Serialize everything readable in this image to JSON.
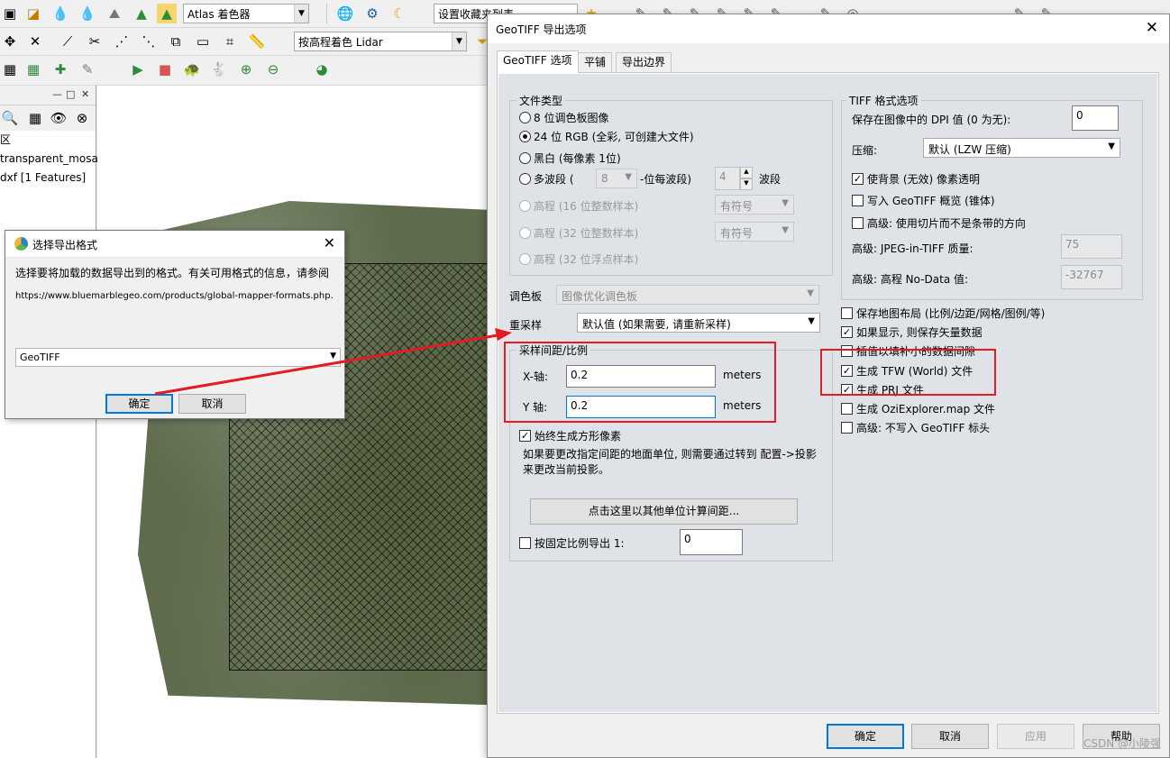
{
  "toolbar": {
    "row1": {
      "shader_select": "Atlas 着色器",
      "favorites_select": "设置收藏夹列表..."
    },
    "row2": {
      "lidar_select": "按高程着色 Lidar"
    }
  },
  "left_panel": {
    "items": [
      "区",
      "transparent_mosa",
      "dxf [1 Features]"
    ]
  },
  "select_format_dialog": {
    "title": "选择导出格式",
    "message": "选择要将加载的数据导出到的格式。有关可用格式的信息，请参阅",
    "url": "https://www.bluemarblegeo.com/products/global-mapper-formats.php.",
    "format_value": "GeoTIFF",
    "ok_label": "确定",
    "cancel_label": "取消"
  },
  "geotiff_dialog": {
    "title": "GeoTIFF 导出选项",
    "tabs": [
      "GeoTIFF 选项",
      "平铺",
      "导出边界"
    ],
    "file_type": {
      "label": "文件类型",
      "opt_8bit": "8 位调色板图像",
      "opt_24bit": "24 位 RGB (全彩, 可创建大文件)",
      "opt_bw": "黑白 (每像素 1位)",
      "opt_multi_prefix": "多波段 (",
      "multi_bits": "8",
      "multi_mid": "-位每波段)",
      "multi_bands": "4",
      "multi_suffix": "波段",
      "opt_elev16": "高程 (16 位整数样本)",
      "elev16_sign": "有符号",
      "opt_elev32i": "高程 (32 位整数样本)",
      "elev32_sign": "有符号",
      "opt_elev32f": "高程 (32 位浮点样本)"
    },
    "palette_label": "调色板",
    "palette_value": "图像优化调色板",
    "resample_label": "重采样",
    "resample_value": "默认值 (如果需要, 请重新采样)",
    "spacing": {
      "label": "采样间距/比例",
      "x_label": "X-轴:",
      "x_value": "0.2",
      "x_unit": "meters",
      "y_label": "Y 轴:",
      "y_value": "0.2",
      "y_unit": "meters",
      "square_label": "始终生成方形像素",
      "note": "如果要更改指定间距的地面单位, 则需要通过转到 配置->投影来更改当前投影。",
      "calc_button": "点击这里以其他单位计算间距...",
      "fixed_scale_label": "按固定比例导出  1:",
      "fixed_scale_value": "0"
    },
    "tiff": {
      "label": "TIFF 格式选项",
      "dpi_label": "保存在图像中的 DPI 值 (0 为无):",
      "dpi_value": "0",
      "compress_label": "压缩:",
      "compress_value": "默认 (LZW 压缩)",
      "transparent_label": "使背景 (无效) 像素透明",
      "overview_label": "写入 GeoTIFF 概览 (锥体)",
      "tiles_label": "高级: 使用切片而不是条带的方向",
      "jpeg_label": "高级: JPEG-in-TIFF 质量:",
      "jpeg_value": "75",
      "nodata_label": "高级: 高程 No-Data 值:",
      "nodata_value": "-32767"
    },
    "checks": {
      "layout": "保存地图布局 (比例/边距/网格/图例/等)",
      "vector": "如果显示, 则保存矢量数据",
      "interp": "插值以填补小的数据间隙",
      "tfw": "生成 TFW (World) 文件",
      "prj": "生成 PRJ 文件",
      "ozi": "生成 OziExplorer.map 文件",
      "no_header": "高级: 不写入 GeoTIFF 标头"
    },
    "buttons": {
      "ok": "确定",
      "cancel": "取消",
      "apply": "应用",
      "help": "帮助"
    }
  },
  "watermark": "CSDN @小陵强",
  "colors": {
    "highlight_red": "#e31b23",
    "focus_blue": "#0078d7"
  }
}
